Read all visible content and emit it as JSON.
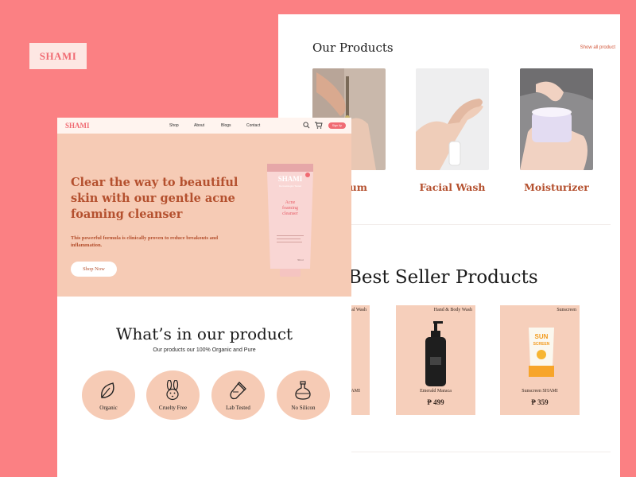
{
  "floating_logo": "SHAMI",
  "back_page": {
    "section_title": "Our Products",
    "show_all": "Show all product",
    "products": [
      {
        "name": "Serum"
      },
      {
        "name": "Facial Wash"
      },
      {
        "name": "Moisturizer"
      }
    ],
    "best_seller_title": "Best Seller Products",
    "best_sellers": [
      {
        "category": "Facial Wash",
        "name": "SHAMI",
        "price": ""
      },
      {
        "category": "Hand & Body Wash",
        "name": "Emerald Maraca",
        "price": "₱ 499"
      },
      {
        "category": "Sunscreen",
        "name": "Sunscreen SHAMI",
        "price": "₱ 359"
      }
    ]
  },
  "front_page": {
    "nav": {
      "logo": "SHAMI",
      "links": [
        "Shop",
        "About",
        "Blogs",
        "Contact"
      ],
      "signup": "Sign Up"
    },
    "hero": {
      "headline": "Clear the way to beautiful skin with our gentle acne foaming cleanser",
      "body": "This powerful formula is clinically proven to reduce breakouts and inflammation.",
      "cta": "Shop Now",
      "tube_brand": "SHAMI",
      "tube_subtitle": "Dermatologist Tested",
      "tube_label": "Acne foaming cleanser",
      "tube_volume": "50 ml"
    },
    "whats_title": "What’s in our product",
    "whats_subtitle": "Our products our 100% Organic and Pure",
    "features": [
      {
        "label": "Organic",
        "icon": "leaf-icon"
      },
      {
        "label": "Cruelty Free",
        "icon": "rabbit-icon"
      },
      {
        "label": "Lab Tested",
        "icon": "test-tube-icon"
      },
      {
        "label": "No Silicon",
        "icon": "flask-icon"
      }
    ]
  },
  "colors": {
    "background": "#fb8083",
    "peach": "#f6cbb5",
    "accent_text": "#b4502e",
    "brand_pink": "#f06b73"
  }
}
